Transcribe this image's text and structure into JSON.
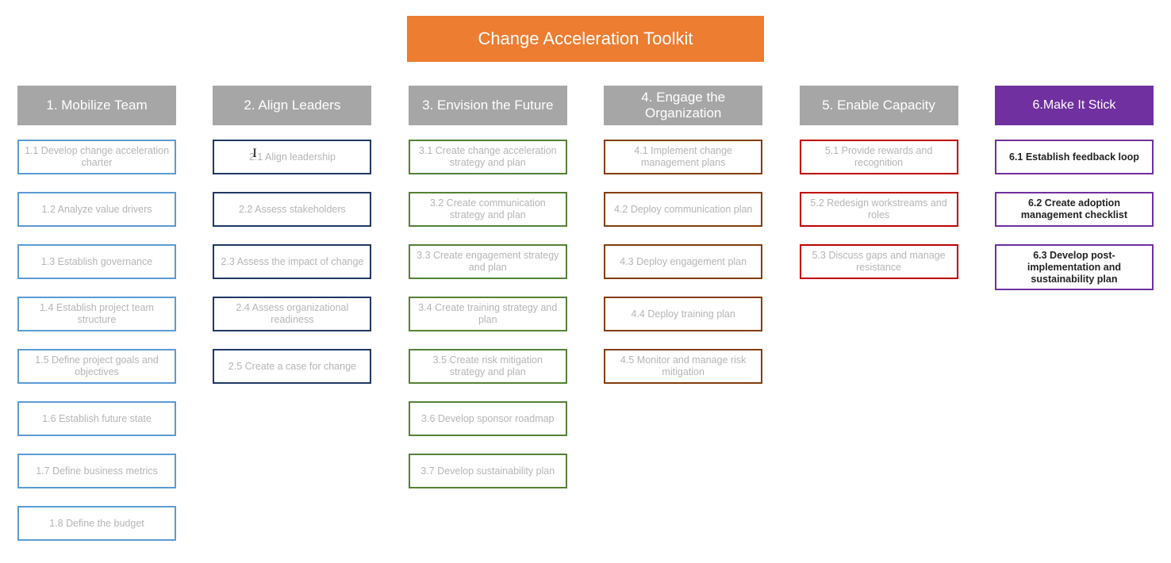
{
  "title": "Change Acceleration Toolkit",
  "columns": [
    {
      "header": "1. Mobilize Team",
      "headerClass": "gray",
      "itemClass": "blue faded",
      "itemStrongOverride": false,
      "items": [
        "1.1 Develop change acceleration charter",
        "1.2 Analyze value drivers",
        "1.3 Establish governance",
        "1.4 Establish project team structure",
        "1.5 Define project goals and objectives",
        "1.6 Establish future state",
        "1.7 Define business metrics",
        "1.8 Define the budget"
      ]
    },
    {
      "header": "2. Align Leaders",
      "headerClass": "gray",
      "itemClass": "navy faded",
      "itemStrongOverride": false,
      "items": [
        "2.1 Align leadership",
        "2.2 Assess stakeholders",
        "2.3 Assess the impact of change",
        "2.4 Assess organizational readiness",
        "2.5 Create a case for change"
      ]
    },
    {
      "header": "3. Envision the Future",
      "headerClass": "gray",
      "itemClass": "green faded",
      "itemStrongOverride": false,
      "items": [
        "3.1 Create change acceleration strategy and plan",
        "3.2 Create communication strategy and plan",
        "3.3 Create engagement strategy and plan",
        "3.4 Create training strategy and plan",
        "3.5 Create risk mitigation strategy and plan",
        "3.6 Develop sponsor roadmap",
        "3.7 Develop sustainability plan"
      ]
    },
    {
      "header": "4. Engage the Organization",
      "headerClass": "gray",
      "itemClass": "brown faded",
      "itemStrongOverride": false,
      "items": [
        "4.1 Implement change management plans",
        "4.2 Deploy communication plan",
        "4.3 Deploy engagement plan",
        "4.4 Deploy training plan",
        "4.5 Monitor and manage risk mitigation"
      ]
    },
    {
      "header": "5. Enable Capacity",
      "headerClass": "gray",
      "itemClass": "red faded",
      "itemStrongOverride": false,
      "items": [
        "5.1 Provide rewards and recognition",
        "5.2 Redesign workstreams and roles",
        "5.3 Discuss gaps and manage resistance"
      ]
    },
    {
      "header": "6.Make It Stick",
      "headerClass": "purple",
      "itemClass": "purple strong",
      "itemStrongOverride": true,
      "items": [
        "6.1 Establish feedback loop",
        "6.2 Create adoption management checklist",
        "6.3 Develop post-implementation and sustainability plan"
      ]
    }
  ],
  "cursor": {
    "column": 1,
    "item": 0,
    "char": "I"
  }
}
